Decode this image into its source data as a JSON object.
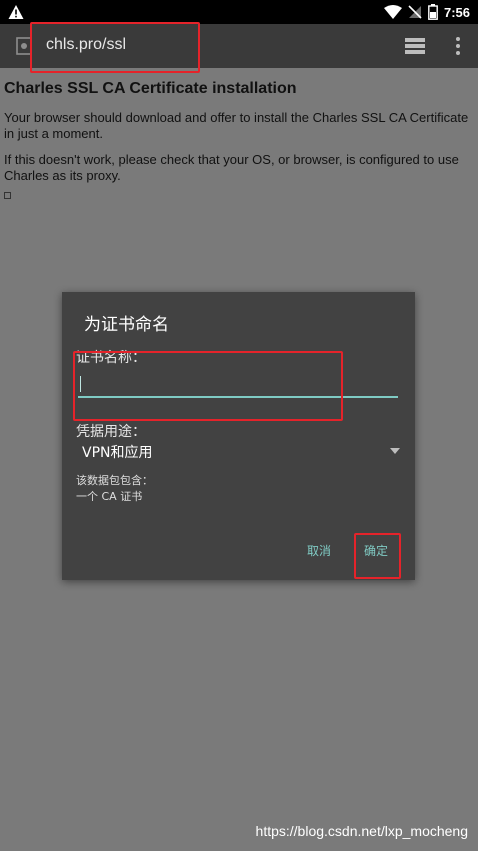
{
  "status_bar": {
    "time": "7:56",
    "icons": [
      "warning-icon",
      "wifi-icon",
      "no-sim-icon",
      "battery-icon"
    ]
  },
  "toolbar": {
    "url": "chls.pro/ssl",
    "icons": [
      "page-icon",
      "tabs-icon",
      "overflow-menu-icon"
    ]
  },
  "page": {
    "title": "Charles SSL CA Certificate installation",
    "paragraph1": "Your browser should download and offer to install the Charles SSL CA Certificate in just a moment.",
    "paragraph2": "If this doesn't work, please check that your OS, or browser, is configured to use Charles as its proxy."
  },
  "dialog": {
    "title": "为证书命名",
    "name_label": "证书名称：",
    "name_value": "",
    "usage_label": "凭据用途：",
    "usage_value": "VPN和应用",
    "info_line1": "该数据包包含：",
    "info_line2": "一个 CA 证书",
    "cancel_label": "取消",
    "ok_label": "确定"
  },
  "watermark": "https://blog.csdn.net/lxp_mocheng",
  "colors": {
    "accent": "#80cbc4",
    "highlight": "#e5232a",
    "dialog_bg": "#424242",
    "scrim_bg": "#7a7a7a"
  }
}
